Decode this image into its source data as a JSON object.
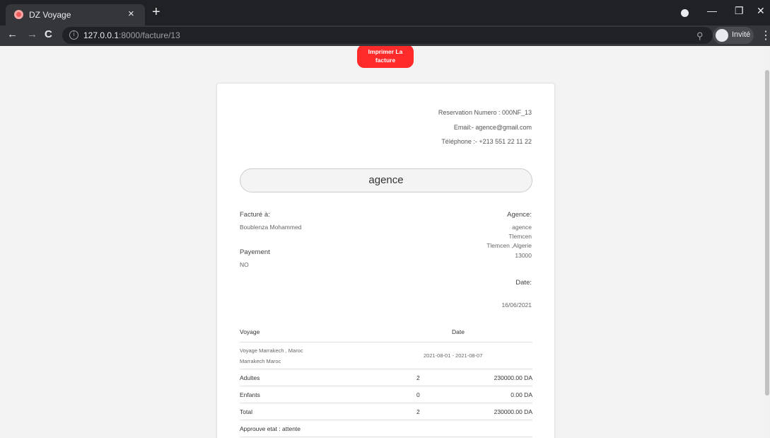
{
  "browser": {
    "tab_title": "DZ Voyage",
    "tab_close": "×",
    "new_tab": "+",
    "url_host": "127.0.0.1",
    "url_path": ":8000/facture/13",
    "profile_label": "Invité",
    "icons": {
      "back": "arrow-left-icon",
      "forward": "arrow-right-icon",
      "reload": "reload-icon",
      "info": "info-icon",
      "zoom": "zoom-icon",
      "menu": "kebab-menu-icon"
    }
  },
  "page": {
    "print_button": [
      "Imprimer La",
      "facture"
    ],
    "reservation": "Reservation Numero : 000NF_13",
    "email": "Email:- agence@gmail.com",
    "telephone": "Téléphone :- +213 551 22 11 22",
    "agency_banner": "agence",
    "billed_to_label": "Facturé à:",
    "billed_to_name": "Boublenza Mohammed",
    "payment_label": "Payement",
    "payment_value": "NO",
    "agency_label": "Agence:",
    "agency_name": "agence",
    "agency_city": "Tlemcen",
    "agency_region": "Tlemcen ,Algerie",
    "agency_zip": "13000",
    "date_label": "Date:",
    "date_value": "16/06/2021",
    "table": {
      "headers": {
        "voyage": "Voyage",
        "date": "Date"
      },
      "trip_name": "Voyage Marrakech , Maroc",
      "trip_place": "Marrakech Maroc",
      "trip_dates": "2021-08-01 - 2021-08-07",
      "rows": [
        {
          "label": "Adultes",
          "qty": "2",
          "amount": "230000.00 DA"
        },
        {
          "label": "Enfants",
          "qty": "0",
          "amount": "0.00 DA"
        },
        {
          "label": "Total",
          "qty": "2",
          "amount": "230000.00 DA"
        }
      ],
      "status": "Approuve etat : attente"
    }
  },
  "colors": {
    "accent": "#ff2a2a",
    "chrome_dark": "#202124",
    "chrome_mid": "#35363a"
  }
}
